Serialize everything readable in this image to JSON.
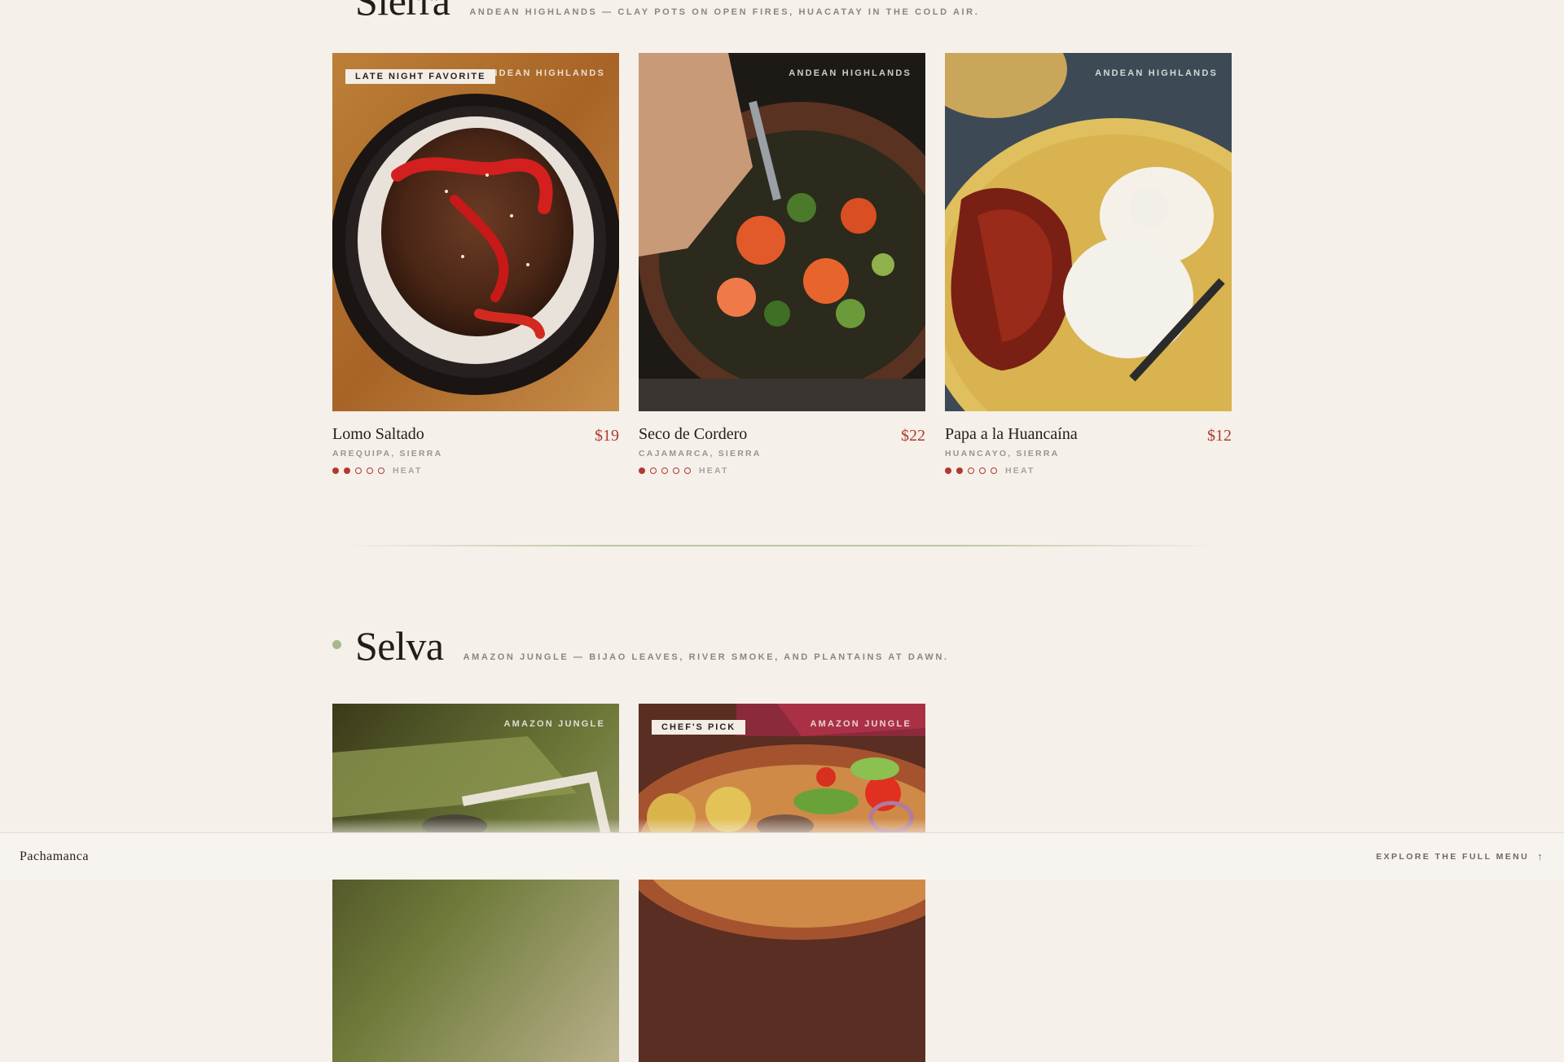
{
  "sections": {
    "sierra": {
      "title": "Sierra",
      "subtitle": "ANDEAN HIGHLANDS — CLAY POTS ON OPEN FIRES, HUACATAY IN THE COLD AIR.",
      "dishes": [
        {
          "name": "Lomo Saltado",
          "price": "$19",
          "origin": "AREQUIPA, SIERRA",
          "region_tag": "ANDEAN HIGHLANDS",
          "badge": "LATE NIGHT FAVORITE",
          "heat": 2,
          "heat_max": 5,
          "heat_label": "HEAT",
          "photo": "beef stir-fry with red peppers over rice in black bowl on wooden board"
        },
        {
          "name": "Seco de Cordero",
          "price": "$22",
          "origin": "CAJAMARCA, SIERRA",
          "region_tag": "ANDEAN HIGHLANDS",
          "badge": "",
          "heat": 1,
          "heat_max": 5,
          "heat_label": "HEAT",
          "photo": "vegetable and herb stew in clay bowl with knife"
        },
        {
          "name": "Papa a la Huancaína",
          "price": "$12",
          "origin": "HUANCAYO, SIERRA",
          "region_tag": "ANDEAN HIGHLANDS",
          "badge": "",
          "heat": 2,
          "heat_max": 5,
          "heat_label": "HEAT",
          "photo": "glazed meat with fried egg and rice on yellow plate"
        }
      ]
    },
    "selva": {
      "title": "Selva",
      "subtitle": "AMAZON JUNGLE — BIJAO LEAVES, RIVER SMOKE, AND PLANTAINS AT DAWN.",
      "dishes": [
        {
          "region_tag": "AMAZON JUNGLE",
          "badge": "",
          "photo": "leaf-wrapped dish"
        },
        {
          "region_tag": "AMAZON JUNGLE",
          "badge": "CHEF'S PICK",
          "photo": "salad with potatoes and tomatoes in clay bowl"
        }
      ]
    }
  },
  "footer": {
    "brand": "Pachamanca",
    "explore_label": "EXPLORE THE FULL MENU",
    "explore_icon": "arrow-up-icon"
  },
  "colors": {
    "background": "#f5f0ea",
    "accent_red": "#b03a2e",
    "section_dot": "#a7b98a"
  }
}
